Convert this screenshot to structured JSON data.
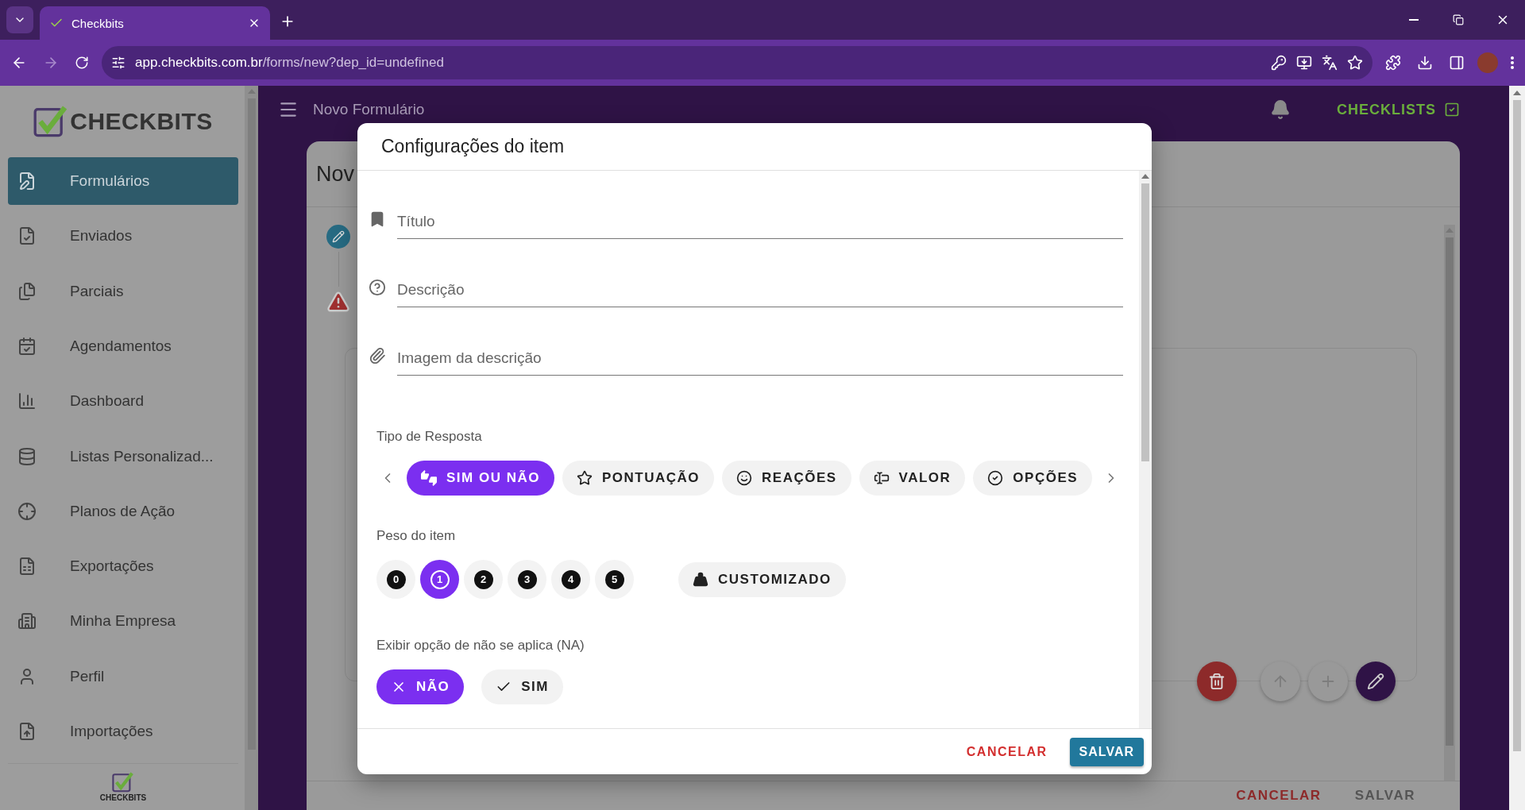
{
  "browser": {
    "tab_title": "Checkbits",
    "url_host": "app.checkbits.com.br",
    "url_path": "/forms/new?dep_id=undefined"
  },
  "sidebar": {
    "logo": "CHECKBITS",
    "items": [
      {
        "label": "Formulários",
        "selected": true
      },
      {
        "label": "Enviados",
        "selected": false
      },
      {
        "label": "Parciais",
        "selected": false
      },
      {
        "label": "Agendamentos",
        "selected": false
      },
      {
        "label": "Dashboard",
        "selected": false
      },
      {
        "label": "Listas Personalizad...",
        "selected": false
      },
      {
        "label": "Planos de Ação",
        "selected": false
      },
      {
        "label": "Exportações",
        "selected": false
      },
      {
        "label": "Minha Empresa",
        "selected": false
      },
      {
        "label": "Perfil",
        "selected": false
      },
      {
        "label": "Importações",
        "selected": false
      }
    ],
    "footer_logo": "CHECKBITS"
  },
  "topbar": {
    "title": "Novo Formulário",
    "checklists": "CHECKLISTS"
  },
  "card": {
    "title": "Nov",
    "actions": [
      "CANCELAR",
      "SALVAR"
    ]
  },
  "dialog": {
    "title": "Configurações do item",
    "fields": [
      {
        "placeholder": "Título"
      },
      {
        "placeholder": "Descrição"
      },
      {
        "placeholder": "Imagem da descrição"
      }
    ],
    "response_type": {
      "label": "Tipo de Resposta",
      "options": [
        {
          "label": "SIM OU NÃO",
          "selected": true
        },
        {
          "label": "PONTUAÇÃO",
          "selected": false
        },
        {
          "label": "REAÇÕES",
          "selected": false
        },
        {
          "label": "VALOR",
          "selected": false
        },
        {
          "label": "OPÇÕES",
          "selected": false
        }
      ]
    },
    "weight": {
      "label": "Peso do item",
      "options": [
        {
          "label": "0",
          "selected": false
        },
        {
          "label": "1",
          "selected": true
        },
        {
          "label": "2",
          "selected": false
        },
        {
          "label": "3",
          "selected": false
        },
        {
          "label": "4",
          "selected": false
        },
        {
          "label": "5",
          "selected": false
        }
      ],
      "custom": {
        "label": "CUSTOMIZADO",
        "selected": false
      }
    },
    "na": {
      "label": "Exibir opção de não se aplica (NA)",
      "options": [
        {
          "label": "NÃO",
          "selected": true
        },
        {
          "label": "SIM",
          "selected": false
        }
      ]
    },
    "actions": [
      "CANCELAR",
      "SALVAR"
    ]
  }
}
